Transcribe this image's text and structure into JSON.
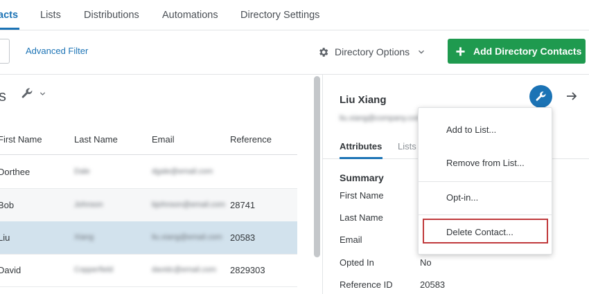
{
  "tabs": [
    "acts",
    "Lists",
    "Distributions",
    "Automations",
    "Directory Settings"
  ],
  "toolbar": {
    "advanced_filter": "Advanced Filter",
    "directory_options": "Directory Options",
    "add_button": "Add Directory Contacts"
  },
  "left": {
    "title": "s",
    "columns": [
      "First Name",
      "Last Name",
      "Email",
      "Reference"
    ],
    "rows": [
      {
        "first": "Dorthee",
        "last": "Dale",
        "email": "dgale@email.com",
        "ref": ""
      },
      {
        "first": "Bob",
        "last": "Johnson",
        "email": "bjohnson@email.com",
        "ref": "28741"
      },
      {
        "first": "Liu",
        "last": "Xiang",
        "email": "liu.xiang@email.com",
        "ref": "20583"
      },
      {
        "first": "David",
        "last": "Copperfield",
        "email": "davidc@email.com",
        "ref": "2829303"
      }
    ]
  },
  "detail": {
    "name": "Liu Xiang",
    "email": "liu.xiang@company.com",
    "tab_attributes": "Attributes",
    "tab_lists": "Lists",
    "summary": "Summary",
    "attributes": [
      {
        "label": "First Name",
        "value": ""
      },
      {
        "label": "Last Name",
        "value": ""
      },
      {
        "label": "Email",
        "value": ""
      },
      {
        "label": "Opted In",
        "value": "No"
      },
      {
        "label": "Reference ID",
        "value": "20583"
      }
    ]
  },
  "menu": {
    "add_to_list": "Add to List...",
    "remove_from_list": "Remove from List...",
    "opt_in": "Opt-in...",
    "delete_contact": "Delete Contact..."
  },
  "colors": {
    "accent": "#1b73b5",
    "add_button": "#1f9a4f",
    "selected_row": "#d2e2ed",
    "highlight_box": "#c0393b"
  },
  "icons": [
    "gear-icon",
    "chevron-down-icon",
    "plus-icon",
    "wrench-icon",
    "arrow-right-icon"
  ]
}
